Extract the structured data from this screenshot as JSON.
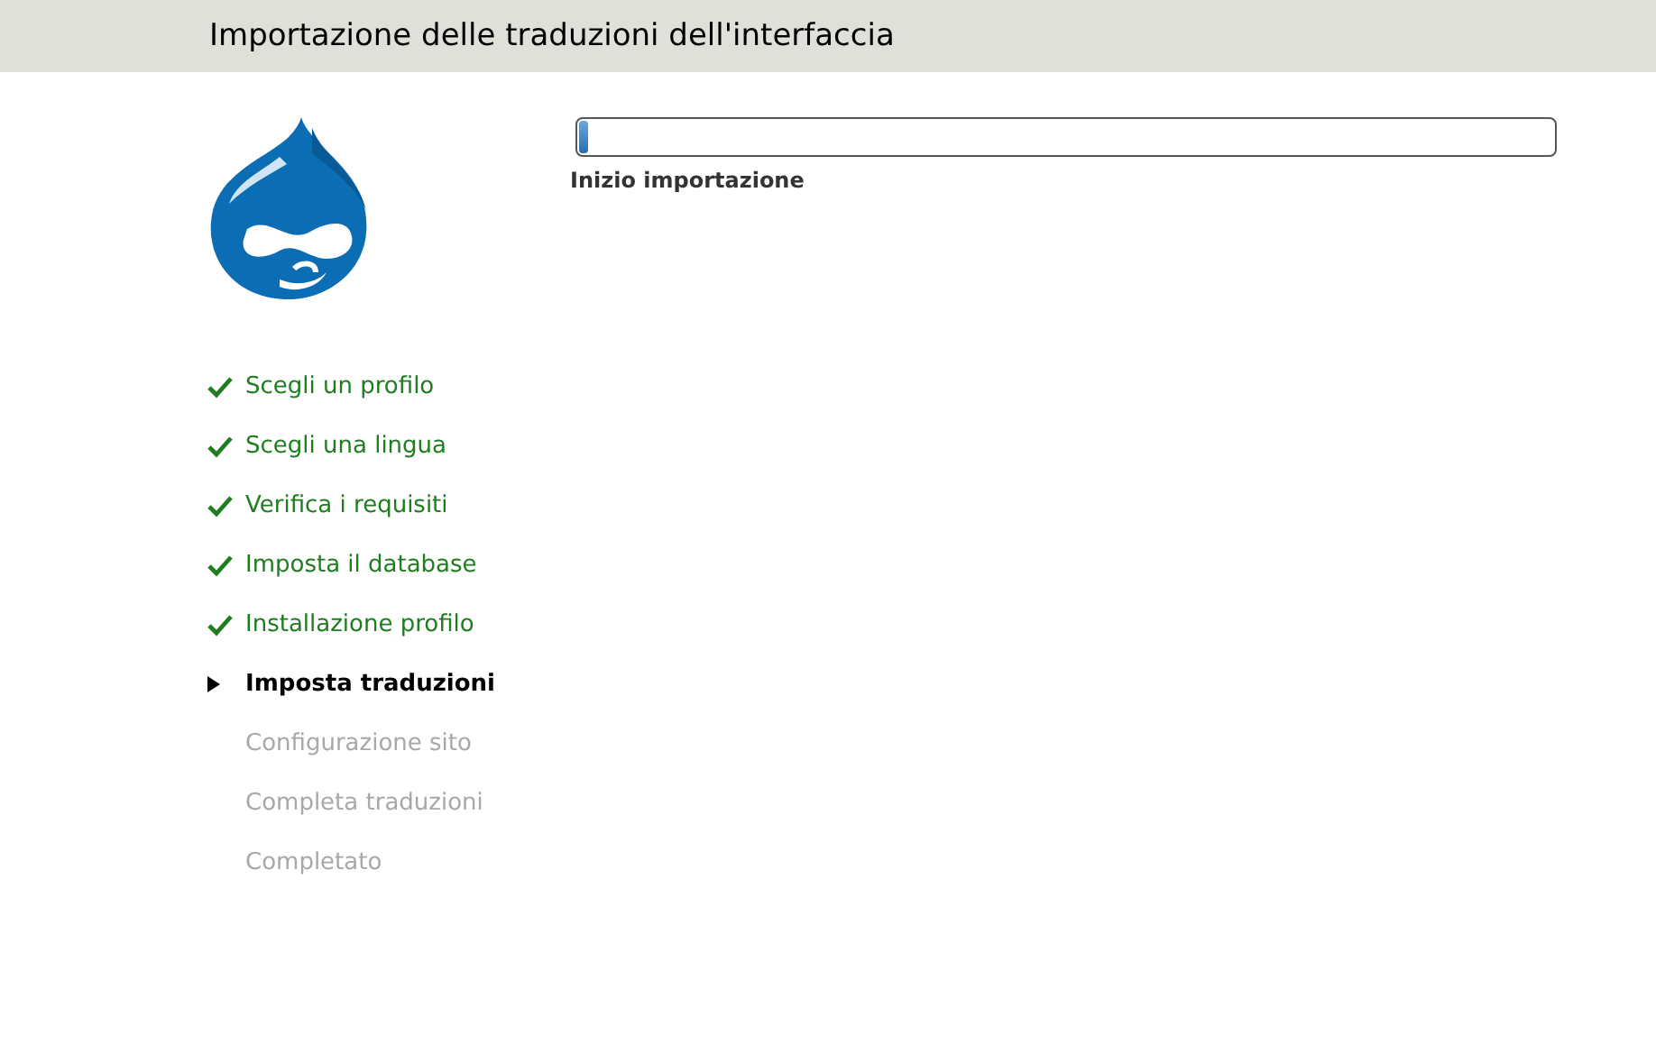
{
  "header": {
    "title": "Importazione delle traduzioni dell'interfaccia"
  },
  "steps": [
    {
      "label": "Scegli un profilo",
      "done": true,
      "selected": false
    },
    {
      "label": "Scegli una lingua",
      "done": true,
      "selected": false
    },
    {
      "label": "Verifica i requisiti",
      "done": true,
      "selected": false
    },
    {
      "label": "Imposta il database",
      "done": true,
      "selected": false
    },
    {
      "label": "Installazione profilo",
      "done": true,
      "selected": false
    },
    {
      "label": "Imposta traduzioni",
      "done": false,
      "selected": true
    },
    {
      "label": "Configurazione sito",
      "done": false,
      "selected": false
    },
    {
      "label": "Completa traduzioni",
      "done": false,
      "selected": false
    },
    {
      "label": "Completato",
      "done": false,
      "selected": false
    }
  ],
  "progress": {
    "level": 0.01,
    "message": "Inizio importazione"
  }
}
